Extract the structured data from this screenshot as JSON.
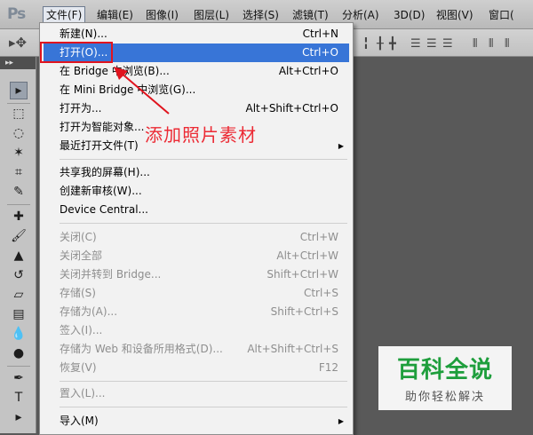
{
  "menubar": {
    "logo": "Ps",
    "items": [
      "文件(F)",
      "编辑(E)",
      "图像(I)",
      "图层(L)",
      "选择(S)",
      "滤镜(T)",
      "分析(A)",
      "3D(D)",
      "视图(V)",
      "窗口("
    ]
  },
  "file_menu": [
    {
      "label": "新建(N)...",
      "shortcut": "Ctrl+N"
    },
    {
      "label": "打开(O)...",
      "shortcut": "Ctrl+O"
    },
    {
      "label": "在 Bridge 中浏览(B)...",
      "shortcut": "Alt+Ctrl+O"
    },
    {
      "label": "在 Mini Bridge 中浏览(G)...",
      "shortcut": ""
    },
    {
      "label": "打开为...",
      "shortcut": "Alt+Shift+Ctrl+O"
    },
    {
      "label": "打开为智能对象...",
      "shortcut": ""
    },
    {
      "label": "最近打开文件(T)",
      "shortcut": ""
    },
    {
      "label": "共享我的屏幕(H)...",
      "shortcut": ""
    },
    {
      "label": "创建新审核(W)...",
      "shortcut": ""
    },
    {
      "label": "Device Central...",
      "shortcut": ""
    },
    {
      "label": "关闭(C)",
      "shortcut": "Ctrl+W"
    },
    {
      "label": "关闭全部",
      "shortcut": "Alt+Ctrl+W"
    },
    {
      "label": "关闭并转到 Bridge...",
      "shortcut": "Shift+Ctrl+W"
    },
    {
      "label": "存储(S)",
      "shortcut": "Ctrl+S"
    },
    {
      "label": "存储为(A)...",
      "shortcut": "Shift+Ctrl+S"
    },
    {
      "label": "签入(I)...",
      "shortcut": ""
    },
    {
      "label": "存储为 Web 和设备所用格式(D)...",
      "shortcut": "Alt+Shift+Ctrl+S"
    },
    {
      "label": "恢复(V)",
      "shortcut": "F12"
    },
    {
      "label": "置入(L)...",
      "shortcut": ""
    },
    {
      "label": "导入(M)",
      "shortcut": ""
    }
  ],
  "annotation": "添加照片素材",
  "watermark": {
    "title": "百科全说",
    "subtitle": "助你轻松解决"
  },
  "colors": {
    "highlight": "#3875d7",
    "annotation_red": "#e0141e",
    "watermark_green": "#1e9e3c"
  }
}
